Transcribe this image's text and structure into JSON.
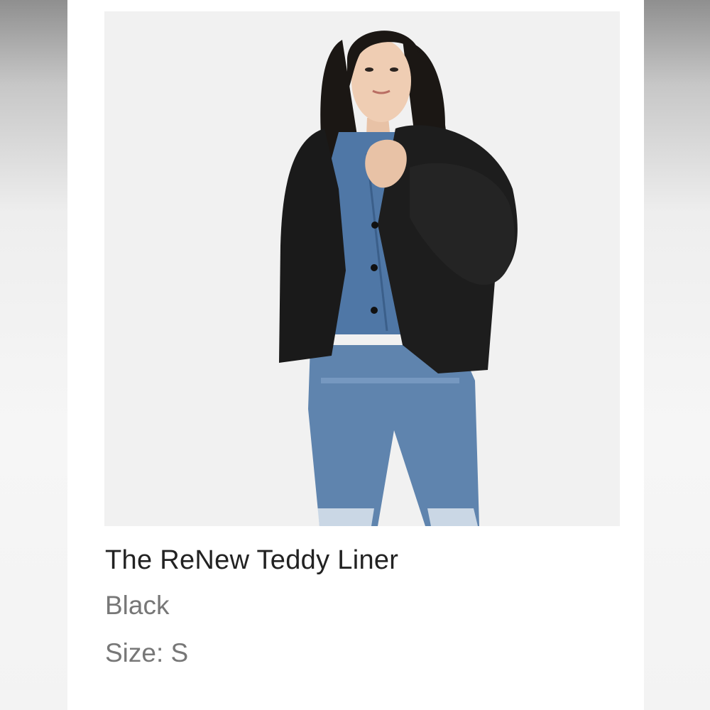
{
  "product": {
    "title": "The ReNew Teddy Liner",
    "color": "Black",
    "size": "Size: S",
    "image_icon": "product-photo"
  },
  "colors": {
    "photo_background": "#f1f1f1",
    "title_text": "#222222",
    "secondary_text": "#777777"
  }
}
